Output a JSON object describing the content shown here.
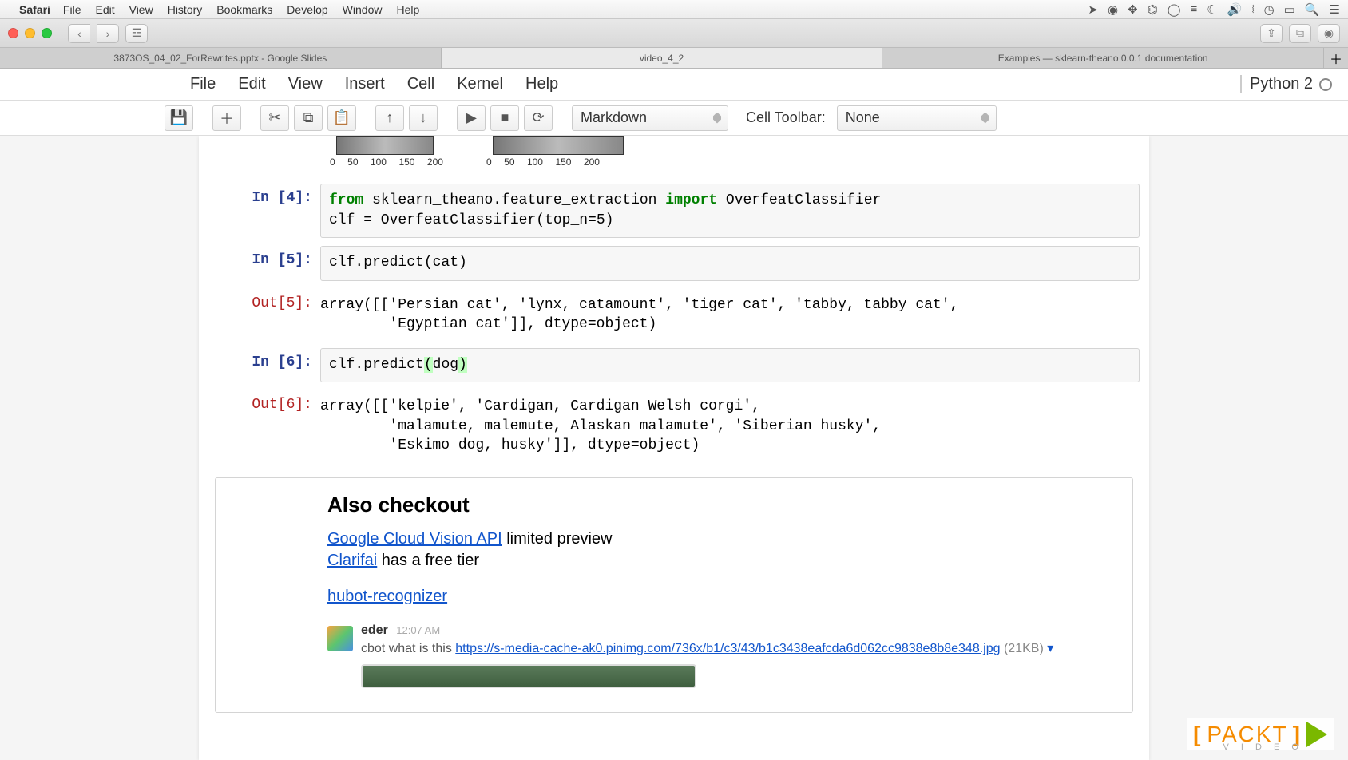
{
  "mac": {
    "app": "Safari",
    "menus": [
      "File",
      "Edit",
      "View",
      "History",
      "Bookmarks",
      "Develop",
      "Window",
      "Help"
    ]
  },
  "tabs": {
    "t1": "3873OS_04_02_ForRewrites.pptx - Google Slides",
    "t2": "video_4_2",
    "t3": "Examples — sklearn-theano 0.0.1 documentation"
  },
  "nb": {
    "menus": [
      "File",
      "Edit",
      "View",
      "Insert",
      "Cell",
      "Kernel",
      "Help"
    ],
    "kernel": "Python 2",
    "cellType": "Markdown",
    "cellToolbarLabel": "Cell Toolbar:",
    "cellToolbar": "None"
  },
  "axis": {
    "y200": "200",
    "xticks": [
      "0",
      "50",
      "100",
      "150",
      "200"
    ]
  },
  "cells": {
    "in4p": "In [4]:",
    "in4a": "from",
    "in4b": " sklearn_theano.feature_extraction ",
    "in4c": "import",
    "in4d": " OverfeatClassifier\nclf = OverfeatClassifier(top_n=5)",
    "in5p": "In [5]:",
    "in5": "clf.predict(cat)",
    "out5p": "Out[5]:",
    "out5": "array([['Persian cat', 'lynx, catamount', 'tiger cat', 'tabby, tabby cat',\n        'Egyptian cat']], dtype=object)",
    "in6p": "In [6]:",
    "in6a": "clf.predict",
    "in6b": "(",
    "in6c": "dog",
    "in6d": ")",
    "out6p": "Out[6]:",
    "out6": "array([['kelpie', 'Cardigan, Cardigan Welsh corgi',\n        'malamute, malemute, Alaskan malamute', 'Siberian husky',\n        'Eskimo dog, husky']], dtype=object)"
  },
  "md": {
    "heading": "Also checkout",
    "link1": "Google Cloud Vision API",
    "link1_after": " limited preview",
    "link2": "Clarifai",
    "link2_after": " has a free tier",
    "link3": "hubot-recognizer",
    "chat_name": "eder",
    "chat_time": "12:07 AM",
    "chat_prefix": "cbot what is this ",
    "chat_url": "https://s-media-cache-ak0.pinimg.com/736x/b1/c3/43/b1c3438eafcda6d062cc9838e8b8e348.jpg",
    "chat_size": " (21KB) ",
    "chat_caret": "▾"
  },
  "watermark": {
    "t1": "[",
    "t2": "PACKT",
    "t3": "]",
    "sub": "V I D E O"
  }
}
